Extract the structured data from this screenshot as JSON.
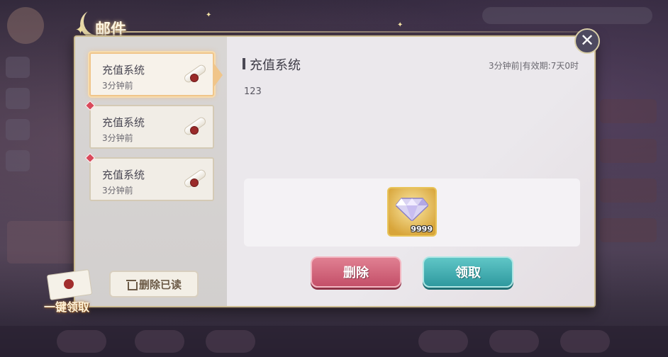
{
  "window_title": "邮件",
  "mail_list": [
    {
      "title": "充值系统",
      "time": "3分钟前",
      "selected": true,
      "unread": false
    },
    {
      "title": "充值系统",
      "time": "3分钟前",
      "selected": false,
      "unread": true
    },
    {
      "title": "充值系统",
      "time": "3分钟前",
      "selected": false,
      "unread": true
    }
  ],
  "delete_read_label": "删除已读",
  "claim_all_label": "一键领取",
  "detail": {
    "title": "充值系统",
    "meta": "3分钟前|有效期:7天0时",
    "body": "123"
  },
  "reward": {
    "icon": "diamond-icon",
    "count": "9999"
  },
  "buttons": {
    "delete": "删除",
    "claim": "领取",
    "close": "✕"
  },
  "colors": {
    "delete_button": "#c44f68",
    "claim_button": "#2f999f",
    "selected_border": "#f0c58a",
    "unread_dot": "#d94a5b"
  }
}
